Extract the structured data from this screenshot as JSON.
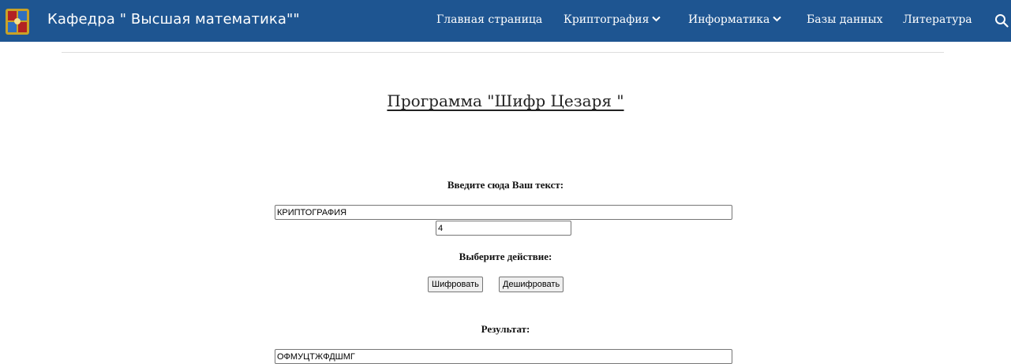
{
  "header": {
    "site_title": "Кафедра \" Высшая математика\"\"",
    "nav": {
      "home": "Главная страница",
      "crypto": "Криптография",
      "informatics": "Информатика",
      "databases": "Базы данных",
      "literature": "Литература"
    },
    "icons": {
      "logo": "university-crest-icon",
      "search": "search-icon",
      "dropdown": "chevron-down-icon"
    }
  },
  "main": {
    "title": "Программа \"Шифр Цезаря \"",
    "input_label": "Введите сюда Ваш текст:",
    "input_value": "КРИПТОГРАФИЯ",
    "shift_value": "4",
    "action_label": "Выберите действие:",
    "encrypt_button": "Шифровать",
    "decrypt_button": "Дешифровать",
    "result_label": "Результат:",
    "result_value": "ОФМУЦТЖФДШМГ"
  },
  "colors": {
    "header_bg": "#1e5591",
    "header_text": "#ffffff"
  }
}
